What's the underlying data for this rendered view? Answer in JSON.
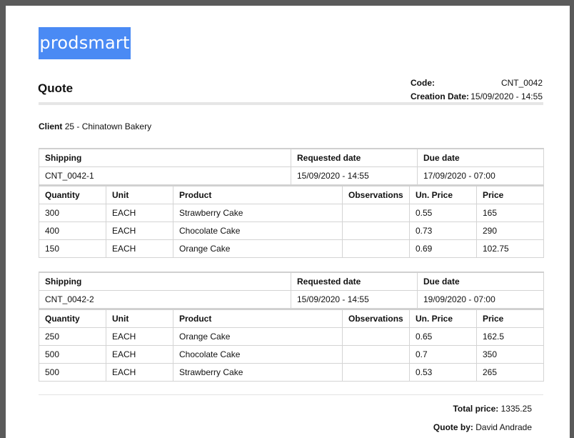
{
  "brand": {
    "logo_text": "prodsmart",
    "logo_color": "#4a8af4"
  },
  "doc": {
    "title": "Quote",
    "code_label": "Code:",
    "code_value": "CNT_0042",
    "date_label": "Creation Date:",
    "date_value": "15/09/2020 - 14:55"
  },
  "client": {
    "label": "Client",
    "value": "25 - Chinatown Bakery"
  },
  "headers": {
    "shipping": "Shipping",
    "requested": "Requested date",
    "due": "Due date",
    "quantity": "Quantity",
    "unit": "Unit",
    "product": "Product",
    "observations": "Observations",
    "unit_price": "Un. Price",
    "price": "Price"
  },
  "shipments": [
    {
      "code": "CNT_0042-1",
      "requested": "15/09/2020 - 14:55",
      "due": "17/09/2020 - 07:00",
      "items": [
        {
          "quantity": "300",
          "unit": "EACH",
          "product": "Strawberry Cake",
          "observations": "",
          "unit_price": "0.55",
          "price": "165"
        },
        {
          "quantity": "400",
          "unit": "EACH",
          "product": "Chocolate Cake",
          "observations": "",
          "unit_price": "0.73",
          "price": "290"
        },
        {
          "quantity": "150",
          "unit": "EACH",
          "product": "Orange Cake",
          "observations": "",
          "unit_price": "0.69",
          "price": "102.75"
        }
      ]
    },
    {
      "code": "CNT_0042-2",
      "requested": "15/09/2020 - 14:55",
      "due": "19/09/2020 - 07:00",
      "items": [
        {
          "quantity": "250",
          "unit": "EACH",
          "product": "Orange Cake",
          "observations": "",
          "unit_price": "0.65",
          "price": "162.5"
        },
        {
          "quantity": "500",
          "unit": "EACH",
          "product": "Chocolate Cake",
          "observations": "",
          "unit_price": "0.7",
          "price": "350"
        },
        {
          "quantity": "500",
          "unit": "EACH",
          "product": "Strawberry Cake",
          "observations": "",
          "unit_price": "0.53",
          "price": "265"
        }
      ]
    }
  ],
  "summary": {
    "total_label": "Total price:",
    "total_value": "1335.25",
    "quoteby_label": "Quote by:",
    "quoteby_value": "David Andrade"
  }
}
